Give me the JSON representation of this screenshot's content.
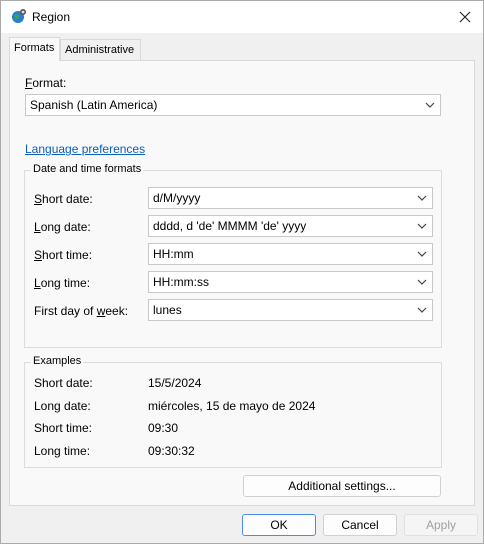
{
  "window": {
    "title": "Region"
  },
  "tabs": [
    {
      "label": "Formats",
      "active": true
    },
    {
      "label": "Administrative",
      "active": false
    }
  ],
  "format": {
    "label": "Format:",
    "value": "Spanish (Latin America)"
  },
  "language_link": "Language preferences",
  "date_time": {
    "group_title": "Date and time formats",
    "rows": [
      {
        "label": "Short date:",
        "value": "d/M/yyyy"
      },
      {
        "label": "Long date:",
        "value": "dddd, d 'de' MMMM 'de' yyyy"
      },
      {
        "label": "Short time:",
        "value": "HH:mm"
      },
      {
        "label": "Long time:",
        "value": "HH:mm:ss"
      },
      {
        "label": "First day of week:",
        "value": "lunes"
      }
    ]
  },
  "examples": {
    "group_title": "Examples",
    "rows": [
      {
        "label": "Short date:",
        "value": "15/5/2024"
      },
      {
        "label": "Long date:",
        "value": "miércoles, 15 de mayo de 2024"
      },
      {
        "label": "Short time:",
        "value": "09:30"
      },
      {
        "label": "Long time:",
        "value": "09:30:32"
      }
    ]
  },
  "buttons": {
    "additional": "Additional settings...",
    "ok": "OK",
    "cancel": "Cancel",
    "apply": "Apply"
  },
  "colors": {
    "link": "#0a5fb8",
    "accent": "#4a8de0"
  }
}
